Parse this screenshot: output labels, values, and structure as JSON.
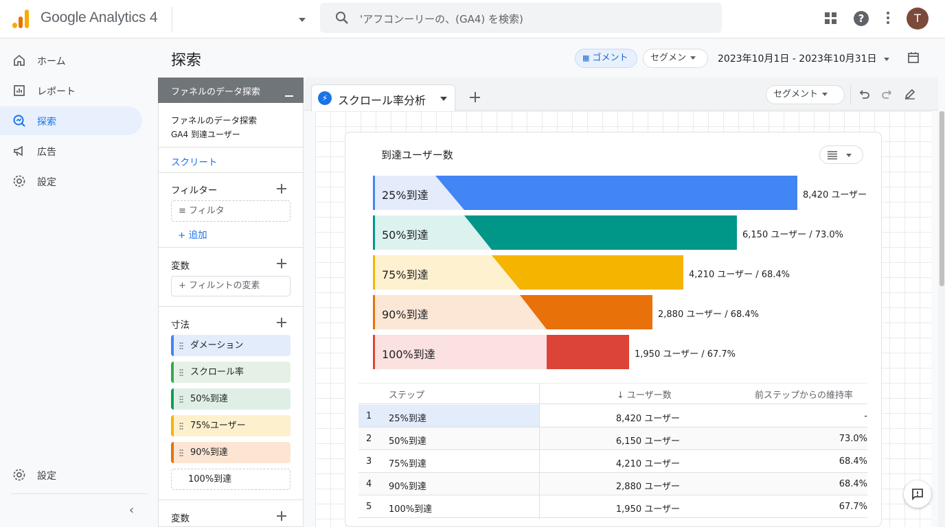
{
  "app": {
    "title": "Google Analytics 4"
  },
  "search": {
    "placeholder": "'アフコンーリーの、(GA4) を検索)"
  },
  "user": {
    "avatar_letter": "T"
  },
  "nav": {
    "items": [
      {
        "label": "ホーム",
        "icon": "home-icon"
      },
      {
        "label": "レポート",
        "icon": "reports-icon"
      },
      {
        "label": "探索",
        "icon": "explore-icon",
        "active": true
      },
      {
        "label": "広告",
        "icon": "advertising-icon"
      },
      {
        "label": "設定",
        "icon": "gear-icon"
      }
    ],
    "bottom_settings": "設定"
  },
  "page": {
    "title": "探索",
    "comment_chip": "ゴメント",
    "segment_chip": "セグメン",
    "date_range": "2023年10月1日 - 2023年10月31日"
  },
  "variables": {
    "header": "ファネルのデータ探索",
    "name_line1": "ファネルのデータ探索",
    "name_line2": "GA4 到達ユーザー",
    "script_link": "スクリート",
    "filter_label": "フィルター",
    "filter_placeholder": "フィルタ",
    "add_link": "+ 追加",
    "variables_label": "変数",
    "variables_box": "+ フィルントの変素",
    "dimensions_label": "寸法",
    "dimensions": [
      {
        "label": "ダメーション",
        "color": "#4285f4",
        "bg": "#e3ecfb"
      },
      {
        "label": "スクロール率",
        "color": "#34a853",
        "bg": "#e6f1e6"
      },
      {
        "label": "50%到達",
        "color": "#0f9d58",
        "bg": "#e0efe6"
      },
      {
        "label": "75%ユーザー",
        "color": "#f4b400",
        "bg": "#fdf0cc"
      },
      {
        "label": "90%到達",
        "color": "#e37400",
        "bg": "#fce5d2"
      }
    ],
    "dimension_empty": "100%到達",
    "variables_label2": "変数"
  },
  "tabs": {
    "active_label": "スクロール率分析",
    "segment_chip": "セグメント"
  },
  "funnel": {
    "title": "到達ユーザー数",
    "colors": [
      "#4285f4",
      "#009688",
      "#f4b400",
      "#e8710a",
      "#db4437"
    ],
    "light_colors": [
      "#e4ecfb",
      "#dcf2ef",
      "#fdf1d0",
      "#fce7d6",
      "#fbe1df"
    ],
    "steps": [
      {
        "label": "25%到達",
        "value_text": "8,420 ユーザー"
      },
      {
        "label": "50%到達",
        "value_text": "6,150 ユーザー / 73.0%"
      },
      {
        "label": "75%到達",
        "value_text": "4,210 ユーザー / 68.4%"
      },
      {
        "label": "90%到達",
        "value_text": "2,880 ユーザー / 68.4%"
      },
      {
        "label": "100%到達",
        "value_text": "1,950 ユーザー / 67.7%"
      }
    ]
  },
  "chart_data": {
    "type": "bar",
    "title": "到達ユーザー数",
    "categories": [
      "25%到達",
      "50%到達",
      "75%到達",
      "90%到達",
      "100%到達"
    ],
    "values": [
      8420,
      6150,
      4210,
      2880,
      1950
    ],
    "retention": [
      null,
      73.0,
      68.4,
      68.4,
      67.7
    ],
    "orientation": "horizontal"
  },
  "table": {
    "headers": {
      "step": "ステップ",
      "users": "↓ ユーザー数",
      "rate": "前ステップからの維持率"
    },
    "rows": [
      {
        "num": "1",
        "step": "25%到達",
        "users": "8,420 ユーザー",
        "rate": "-"
      },
      {
        "num": "2",
        "step": "50%到達",
        "users": "6,150 ユーザー",
        "rate": "73.0%"
      },
      {
        "num": "3",
        "step": "75%到達",
        "users": "4,210 ユーザー",
        "rate": "68.4%"
      },
      {
        "num": "4",
        "step": "90%到達",
        "users": "2,880 ユーザー",
        "rate": "68.4%"
      },
      {
        "num": "5",
        "step": "100%到達",
        "users": "1,950 ユーザー",
        "rate": "67.7%"
      }
    ]
  }
}
